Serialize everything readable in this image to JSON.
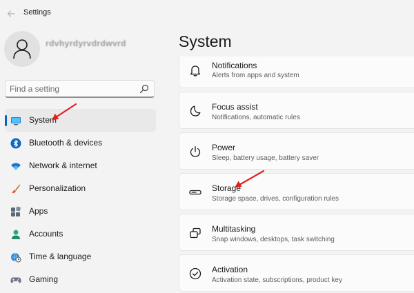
{
  "window": {
    "title": "Settings"
  },
  "account": {
    "name": "rdvhyrdyrvdrdwvrd"
  },
  "search": {
    "placeholder": "Find a setting"
  },
  "sidebar": {
    "items": [
      {
        "label": "System",
        "icon": "monitor-icon",
        "active": true
      },
      {
        "label": "Bluetooth & devices",
        "icon": "bluetooth-icon"
      },
      {
        "label": "Network & internet",
        "icon": "wifi-icon"
      },
      {
        "label": "Personalization",
        "icon": "brush-icon"
      },
      {
        "label": "Apps",
        "icon": "apps-icon"
      },
      {
        "label": "Accounts",
        "icon": "person-icon"
      },
      {
        "label": "Time & language",
        "icon": "globe-clock-icon"
      },
      {
        "label": "Gaming",
        "icon": "gamepad-icon"
      }
    ]
  },
  "main": {
    "title": "System",
    "cards": [
      {
        "title": "Notifications",
        "subtitle": "Alerts from apps and system",
        "icon": "bell-icon"
      },
      {
        "title": "Focus assist",
        "subtitle": "Notifications, automatic rules",
        "icon": "moon-icon"
      },
      {
        "title": "Power",
        "subtitle": "Sleep, battery usage, battery saver",
        "icon": "power-icon"
      },
      {
        "title": "Storage",
        "subtitle": "Storage space, drives, configuration rules",
        "icon": "drive-icon"
      },
      {
        "title": "Multitasking",
        "subtitle": "Snap windows, desktops, task switching",
        "icon": "multitask-icon"
      },
      {
        "title": "Activation",
        "subtitle": "Activation state, subscriptions, product key",
        "icon": "check-circle-icon"
      }
    ]
  },
  "colors": {
    "accent": "#0067c0",
    "annotation": "#e02020",
    "background": "#f3f3f3",
    "card": "#fbfbfb"
  }
}
